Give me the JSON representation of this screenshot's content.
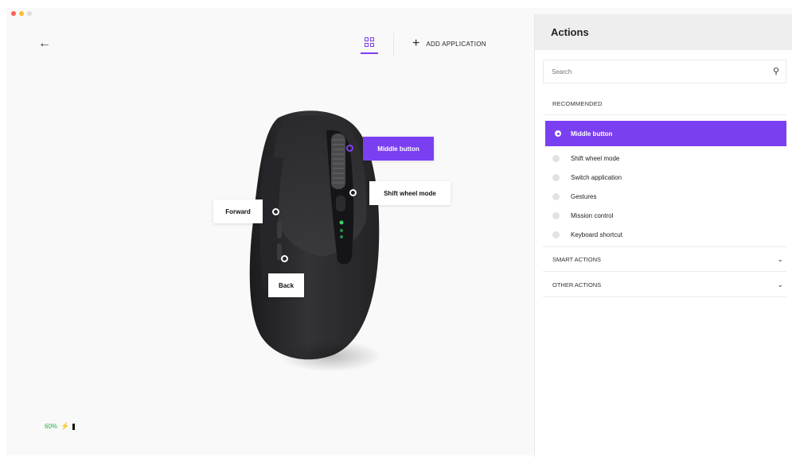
{
  "window": {
    "back_icon": "arrow-left-icon",
    "view_icon": "grid-icon",
    "add_application": {
      "icon": "plus-icon",
      "label": "ADD APPLICATION"
    }
  },
  "device": {
    "callouts": {
      "middle_button": "Middle button",
      "shift_wheel_mode": "Shift wheel mode",
      "forward": "Forward",
      "back": "Back"
    },
    "battery": {
      "percent": "60%",
      "icon": "battery-icon"
    }
  },
  "panel": {
    "title": "Actions",
    "search": {
      "placeholder": "Search",
      "icon": "search-icon"
    },
    "recommended_label": "RECOMMENDED",
    "recommended": [
      {
        "label": "Middle button",
        "selected": true
      },
      {
        "label": "Shift wheel mode",
        "selected": false
      },
      {
        "label": "Switch application",
        "selected": false
      },
      {
        "label": "Gestures",
        "selected": false
      },
      {
        "label": "Mission control",
        "selected": false
      },
      {
        "label": "Keyboard shortcut",
        "selected": false
      }
    ],
    "sections": [
      {
        "label": "SMART ACTIONS",
        "icon": "chevron-down-icon"
      },
      {
        "label": "OTHER ACTIONS",
        "icon": "chevron-down-icon"
      }
    ]
  },
  "colors": {
    "accent": "#7b3ff2",
    "battery": "#27a94a",
    "panel_header": "#eeeeee",
    "canvas": "#f9f9f9"
  }
}
